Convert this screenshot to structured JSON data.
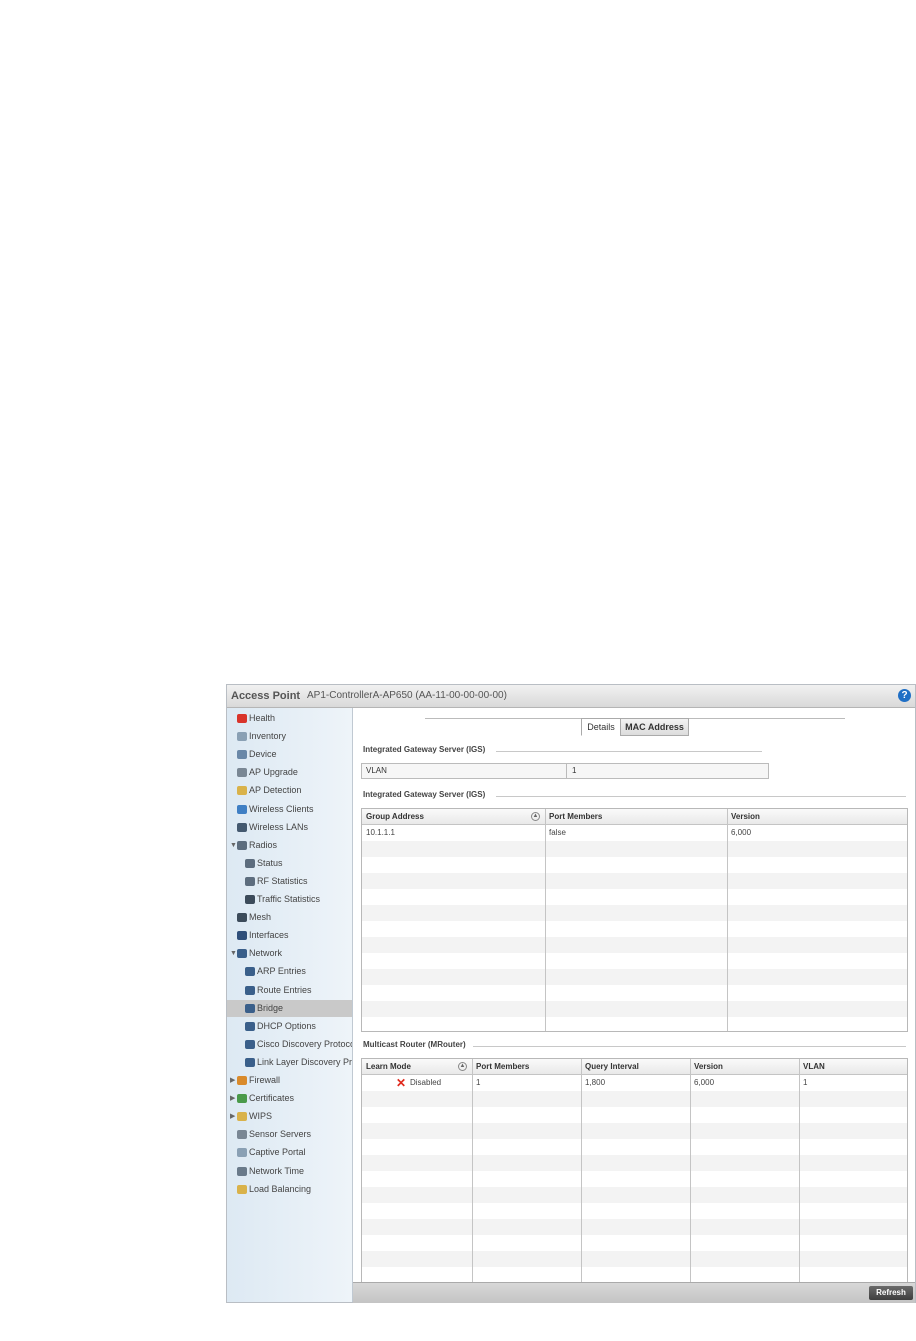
{
  "header": {
    "title": "Access Point",
    "device": "AP1-ControllerA-AP650 (AA-11-00-00-00-00)",
    "help": "?"
  },
  "sidebar": {
    "items": [
      {
        "label": "Health",
        "icon": "health-icon",
        "color": "#d9342b"
      },
      {
        "label": "Inventory",
        "icon": "inventory-icon",
        "color": "#8aa0b4"
      },
      {
        "label": "Device",
        "icon": "device-icon",
        "color": "#6a88a8"
      },
      {
        "label": "AP Upgrade",
        "icon": "ap-upgrade-icon",
        "color": "#7a8794"
      },
      {
        "label": "AP Detection",
        "icon": "ap-detection-icon",
        "color": "#d9b24a"
      },
      {
        "label": "Wireless Clients",
        "icon": "wireless-clients-icon",
        "color": "#3f7fc4"
      },
      {
        "label": "Wireless LANs",
        "icon": "wireless-lans-icon",
        "color": "#44596f"
      },
      {
        "label": "Radios",
        "icon": "radios-icon",
        "color": "#5d6d7e",
        "expanded": true
      },
      {
        "label": "Status",
        "icon": "status-icon",
        "color": "#5d6d7e"
      },
      {
        "label": "RF Statistics",
        "icon": "rf-statistics-icon",
        "color": "#5d6d7e"
      },
      {
        "label": "Traffic Statistics",
        "icon": "traffic-statistics-icon",
        "color": "#3c4b5a"
      },
      {
        "label": "Mesh",
        "icon": "mesh-icon",
        "color": "#3c4b5a"
      },
      {
        "label": "Interfaces",
        "icon": "interfaces-icon",
        "color": "#2f4f7a"
      },
      {
        "label": "Network",
        "icon": "network-icon",
        "color": "#3a5f8a",
        "expanded": true
      },
      {
        "label": "ARP Entries",
        "icon": "arp-entries-icon",
        "color": "#3a5f8a"
      },
      {
        "label": "Route Entries",
        "icon": "route-entries-icon",
        "color": "#3a5f8a"
      },
      {
        "label": "Bridge",
        "icon": "bridge-icon",
        "color": "#3a5f8a",
        "selected": true
      },
      {
        "label": "DHCP Options",
        "icon": "dhcp-options-icon",
        "color": "#3a5f8a"
      },
      {
        "label": "Cisco Discovery Protoco",
        "icon": "cisco-discovery-icon",
        "color": "#3a5f8a"
      },
      {
        "label": "Link Layer Discovery Pr",
        "icon": "link-layer-discovery-icon",
        "color": "#3a5f8a"
      },
      {
        "label": "Firewall",
        "icon": "firewall-icon",
        "color": "#d98a2b",
        "collapsed": true
      },
      {
        "label": "Certificates",
        "icon": "certificates-icon",
        "color": "#4a9a4a",
        "collapsed": true
      },
      {
        "label": "WIPS",
        "icon": "wips-icon",
        "color": "#d9b24a",
        "collapsed": true
      },
      {
        "label": "Sensor Servers",
        "icon": "sensor-servers-icon",
        "color": "#7a8794"
      },
      {
        "label": "Captive Portal",
        "icon": "captive-portal-icon",
        "color": "#8aa0b4"
      },
      {
        "label": "Network Time",
        "icon": "network-time-icon",
        "color": "#6a7a8a"
      },
      {
        "label": "Load Balancing",
        "icon": "load-balancing-icon",
        "color": "#d9b24a"
      }
    ]
  },
  "tabs": [
    {
      "label": "Details",
      "active": true
    },
    {
      "label": "MAC Address",
      "active": false
    }
  ],
  "igs_summary": {
    "title": "Integrated Gateway Server (IGS)",
    "label": "VLAN",
    "value": "1"
  },
  "igs_table": {
    "title": "Integrated Gateway Server (IGS)",
    "columns": [
      "Group Address",
      "Port Members",
      "Version"
    ],
    "sort_symbol": "▲",
    "rows": [
      [
        "10.1.1.1",
        "false",
        "6,000"
      ]
    ]
  },
  "mrouter_table": {
    "title": "Multicast Router (MRouter)",
    "columns": [
      "Learn Mode",
      "Port Members",
      "Query Interval",
      "Version",
      "VLAN"
    ],
    "sort_symbol": "▲",
    "status_icon": "✕",
    "rows": [
      [
        "Disabled",
        "1",
        "1,800",
        "6,000",
        "1"
      ]
    ]
  },
  "footer": {
    "refresh_label": "Refresh"
  }
}
